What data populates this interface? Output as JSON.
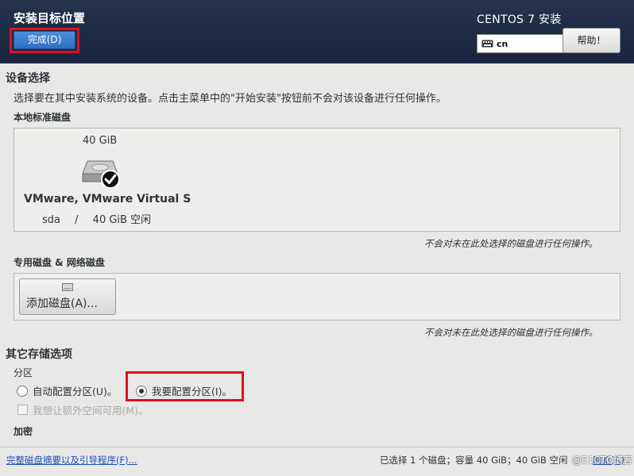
{
  "header": {
    "title": "安装目标位置",
    "done_label": "完成(D)",
    "product": "CENTOS 7 安装",
    "keyboard_layout": "cn",
    "help_label": "帮助！"
  },
  "device_selection": {
    "title": "设备选择",
    "description": "选择要在其中安装系统的设备。点击主菜单中的\"开始安装\"按钮前不会对该设备进行任何操作。",
    "local_disks_label": "本地标准磁盘",
    "disk": {
      "size": "40 GiB",
      "name": "VMware, VMware Virtual S",
      "device": "sda",
      "separator": "/",
      "free": "40 GiB 空闲",
      "selected": true
    },
    "local_note": "不会对未在此处选择的磁盘进行任何操作。",
    "special_disks_label": "专用磁盘 & 网络磁盘",
    "add_disk_label": "添加磁盘(A)...",
    "special_note": "不会对未在此处选择的磁盘进行任何操作。"
  },
  "other_storage": {
    "title": "其它存储选项",
    "partition_label": "分区",
    "auto_partition": "自动配置分区(U)。",
    "manual_partition": "我要配置分区(I)。",
    "selected_option": "manual",
    "extra_space": "我想让额外空间可用(M)。",
    "encryption_label": "加密"
  },
  "footer": {
    "summary_link": "完整磁盘摘要以及引导程序(F)...",
    "status": "已选择 1 个磁盘；容量 40 GiB；40 GiB 空闲",
    "refresh": "刷新(R)"
  },
  "watermark": "@51CTO博客"
}
